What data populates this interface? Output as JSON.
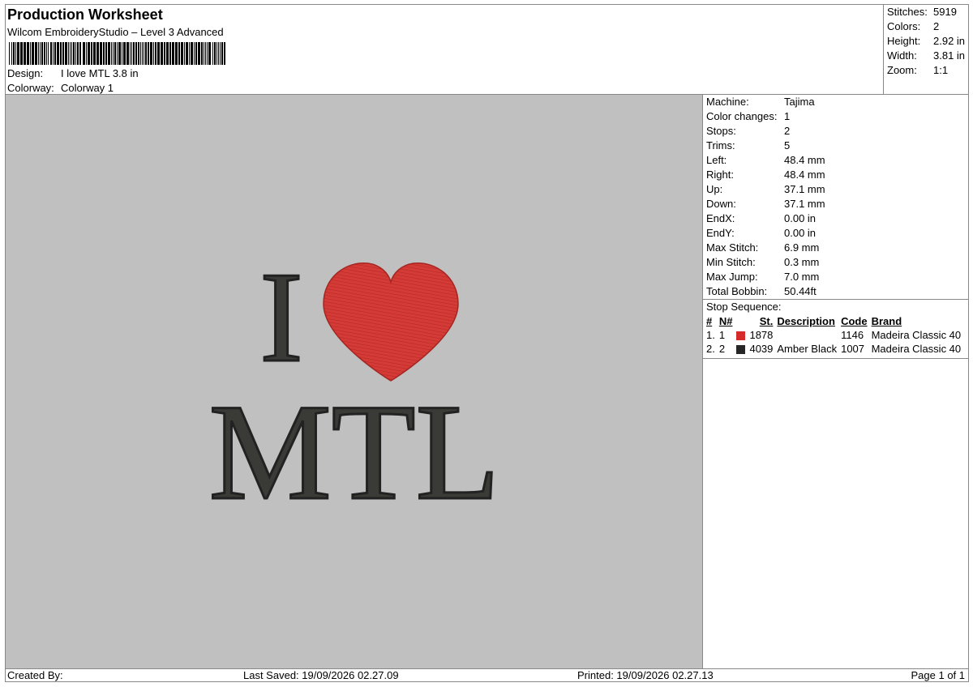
{
  "header": {
    "title": "Production Worksheet",
    "software": "Wilcom EmbroideryStudio – Level 3 Advanced",
    "design_label": "Design:",
    "design_value": "I love MTL 3.8 in",
    "colorway_label": "Colorway:",
    "colorway_value": "Colorway 1"
  },
  "summary": [
    {
      "label": "Stitches:",
      "value": "5919"
    },
    {
      "label": "Colors:",
      "value": "2"
    },
    {
      "label": "Height:",
      "value": "2.92 in"
    },
    {
      "label": "Width:",
      "value": "3.81 in"
    },
    {
      "label": "Zoom:",
      "value": "1:1"
    }
  ],
  "details": [
    {
      "label": "Machine:",
      "value": "Tajima"
    },
    {
      "label": "Color changes:",
      "value": "1"
    },
    {
      "label": "Stops:",
      "value": "2"
    },
    {
      "label": "Trims:",
      "value": "5"
    },
    {
      "label": "Left:",
      "value": "48.4 mm"
    },
    {
      "label": "Right:",
      "value": "48.4 mm"
    },
    {
      "label": "Up:",
      "value": "37.1 mm"
    },
    {
      "label": "Down:",
      "value": "37.1 mm"
    },
    {
      "label": "EndX:",
      "value": "0.00 in"
    },
    {
      "label": "EndY:",
      "value": "0.00 in"
    },
    {
      "label": "Max Stitch:",
      "value": "6.9 mm"
    },
    {
      "label": "Min Stitch:",
      "value": "0.3 mm"
    },
    {
      "label": "Max Jump:",
      "value": "7.0 mm"
    },
    {
      "label": "Total Bobbin:",
      "value": "50.44ft"
    }
  ],
  "stop_sequence": {
    "title": "Stop Sequence:",
    "columns": {
      "num": "#",
      "needle": "N#",
      "stitches": "St.",
      "description": "Description",
      "code": "Code",
      "brand": "Brand"
    },
    "rows": [
      {
        "num": "1.",
        "needle": "1",
        "color": "#d42a2a",
        "stitches": "1878",
        "description": "",
        "code": "1146",
        "brand": "Madeira Classic 40"
      },
      {
        "num": "2.",
        "needle": "2",
        "color": "#262626",
        "stitches": "4039",
        "description": "Amber Black",
        "code": "1007",
        "brand": "Madeira Classic 40"
      }
    ]
  },
  "design_preview": {
    "line1": "I",
    "line2": "MTL",
    "heart_color": "#d43a36",
    "text_color": "#3a3a36",
    "background": "#c0c0c0"
  },
  "footer": {
    "created_by": "Created By:",
    "last_saved": "Last Saved: 19/09/2026 02.27.09",
    "printed": "Printed: 19/09/2026 02.27.13",
    "page": "Page 1 of 1"
  }
}
